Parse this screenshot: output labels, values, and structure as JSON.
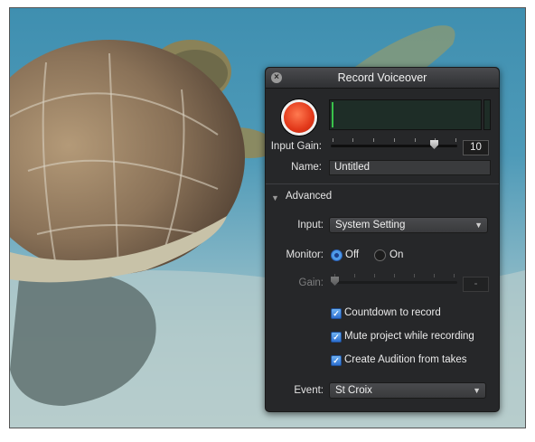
{
  "panel": {
    "title": "Record Voiceover",
    "close_glyph": "×",
    "input_gain_label": "Input Gain:",
    "input_gain_value": "10",
    "name_label": "Name:",
    "name_value": "Untitled",
    "advanced_label": "Advanced",
    "disclosure_glyph": "▼",
    "input_label": "Input:",
    "input_value": "System Setting",
    "monitor_label": "Monitor:",
    "monitor_off": "Off",
    "monitor_on": "On",
    "monitor_selected": "Off",
    "gain_label": "Gain:",
    "gain_value": "-",
    "countdown_label": "Countdown to record",
    "countdown_checked": true,
    "mute_label": "Mute project while recording",
    "mute_checked": true,
    "audition_label": "Create Audition from takes",
    "audition_checked": true,
    "event_label": "Event:",
    "event_value": "St Croix",
    "dropdown_arrow": "▼",
    "check_glyph": "✓"
  },
  "icons": {
    "close": "close-icon",
    "record": "record-icon",
    "disclosure": "disclosure-triangle-icon",
    "dropdown": "chevron-down-icon",
    "checkbox": "checkmark-icon"
  },
  "colors": {
    "record_button": "#e2381a",
    "meter_level": "#39c24a",
    "panel_background": "#262729",
    "selected_accent": "#4e9ae8"
  }
}
